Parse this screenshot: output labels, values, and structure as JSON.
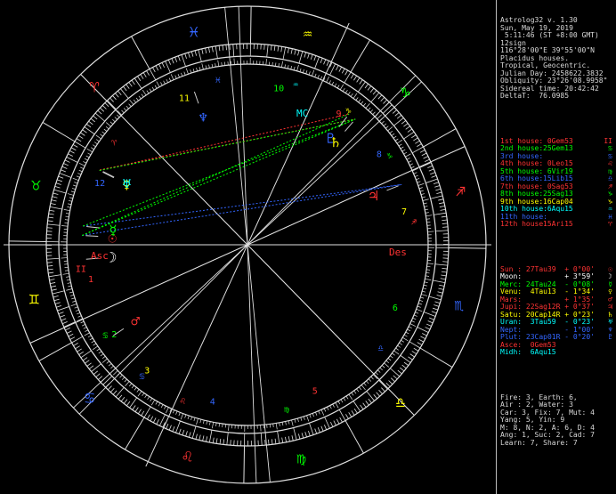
{
  "header": {
    "lines": [
      "Astrolog32 v. 1.30",
      "Sun, May 19, 2019",
      " 5:11:46 (ST +8:00 GMT)",
      "12sign",
      "116°28'00\"E 39°55'00\"N",
      "Placidus houses.",
      "Tropical, Geocentric.",
      "Julian Day: 2458622.3832",
      "Obliquity: 23°26'08.9958\"",
      "Sidereal time: 20:42:42",
      "DeltaT:  76.0985"
    ]
  },
  "houses": [
    {
      "label": "1st house:",
      "value": " 0Gem53",
      "color": "#ff3333",
      "glyph": "II"
    },
    {
      "label": "2nd house:",
      "value": "25Gem13",
      "color": "#00ff00",
      "glyph": "♋"
    },
    {
      "label": "3rd house:",
      "value": "",
      "color": "#3366ff",
      "glyph": "♋"
    },
    {
      "label": "4th house:",
      "value": " 0Leo15",
      "color": "#ff3333",
      "glyph": "♌"
    },
    {
      "label": "5th house:",
      "value": " 6Vir19",
      "color": "#00ff00",
      "glyph": "♍"
    },
    {
      "label": "6th house:",
      "value": "15Lib15",
      "color": "#3366ff",
      "glyph": "♎"
    },
    {
      "label": "7th house:",
      "value": " 0Sag53",
      "color": "#ff3333",
      "glyph": "♐"
    },
    {
      "label": "8th house:",
      "value": "25Sag13",
      "color": "#00ff00",
      "glyph": "♑"
    },
    {
      "label": "9th house:",
      "value": "16Cap04",
      "color": "#ffff00",
      "glyph": "♑"
    },
    {
      "label": "10th house:",
      "value": " 6Aqu15",
      "color": "#00ffff",
      "glyph": "♒"
    },
    {
      "label": "11th house:",
      "value": "",
      "color": "#3366ff",
      "glyph": "♓"
    },
    {
      "label": "12th house:",
      "value": "15Ari15",
      "color": "#ff3333",
      "glyph": "♈"
    }
  ],
  "planets": [
    {
      "label": "Sun :",
      "value": " 27Tau39  + 0°00'",
      "color": "#ff3333",
      "glyph": "☉"
    },
    {
      "label": "Moon:",
      "value": "          + 3°59'",
      "color": "#ffffff",
      "glyph": "☽"
    },
    {
      "label": "Merc:",
      "value": " 24Tau24  - 0°08'",
      "color": "#00ff00",
      "glyph": "☿"
    },
    {
      "label": "Venu:",
      "value": "  4Tau13  - 1°34'",
      "color": "#ffff00",
      "glyph": "♀"
    },
    {
      "label": "Mars:",
      "value": "          + 1°35'",
      "color": "#ff3333",
      "glyph": "♂"
    },
    {
      "label": "Jupi:",
      "value": " 22Sag12R + 0°37'",
      "color": "#ff3333",
      "glyph": "♃"
    },
    {
      "label": "Satu:",
      "value": " 20Cap14R + 0°23'",
      "color": "#ffff00",
      "glyph": "♄"
    },
    {
      "label": "Uran:",
      "value": "  3Tau59  - 0°23'",
      "color": "#00ffff",
      "glyph": "♅"
    },
    {
      "label": "Nept:",
      "value": "          - 1°00'",
      "color": "#3366ff",
      "glyph": "♆"
    },
    {
      "label": "Plut:",
      "value": " 23Cap01R - 0°20'",
      "color": "#3366ff",
      "glyph": "♇"
    },
    {
      "label": "Asce:",
      "value": "  0Gem53",
      "color": "#ff3333",
      "glyph": ""
    },
    {
      "label": "Midh:",
      "value": "  6Aqu15",
      "color": "#00ffff",
      "glyph": ""
    }
  ],
  "stats": [
    "Fire: 3, Earth: 6,",
    "Air : 2, Water: 3",
    "Car: 3, Fix: 7, Mut: 4",
    "Yang: 5, Yin: 9",
    "M: 8, N: 2, A: 6, D: 4",
    "Ang: 1, Suc: 2, Cad: 7",
    "Learn: 7, Share: 7"
  ],
  "wheel": {
    "house_numbers": [
      "1",
      "2",
      "3",
      "4",
      "5",
      "6",
      "7",
      "8",
      "9",
      "10",
      "11",
      "12"
    ],
    "angle_labels": {
      "asc": "Asc",
      "des": "Des",
      "mc": "MC",
      "ic": "IC"
    },
    "colors": {
      "fire": "#ff3333",
      "earth": "#00ff00",
      "air": "#ffff00",
      "water": "#3366ff",
      "line": "#e0e0e0"
    }
  }
}
